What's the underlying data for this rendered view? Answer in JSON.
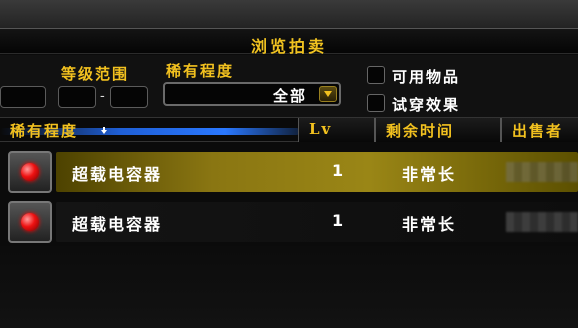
{
  "window": {
    "title": "浏览拍卖"
  },
  "filters": {
    "level_range_label": "等级范围",
    "level_separator": "-",
    "rarity_label": "稀有程度",
    "rarity_value": "全部",
    "checkboxes": [
      {
        "label": "可用物品",
        "checked": false
      },
      {
        "label": "试穿效果",
        "checked": false
      }
    ]
  },
  "columns": {
    "rarity": "稀有程度",
    "level": "Lv",
    "time_left": "剩余时间",
    "seller": "出售者"
  },
  "rows": [
    {
      "name": "超载电容器",
      "level": "1",
      "time_left": "非常长",
      "selected": true
    },
    {
      "name": "超载电容器",
      "level": "1",
      "time_left": "非常长",
      "selected": false
    }
  ],
  "colors": {
    "gold": "#f2c11f",
    "selected_row": "#8a7612",
    "sort_bar": "#2a78ff",
    "item_gem": "#e11111"
  },
  "icons": {
    "dropdown": "arrow-down-icon",
    "sort": "sort-down-icon",
    "item": "red-gem-icon"
  }
}
